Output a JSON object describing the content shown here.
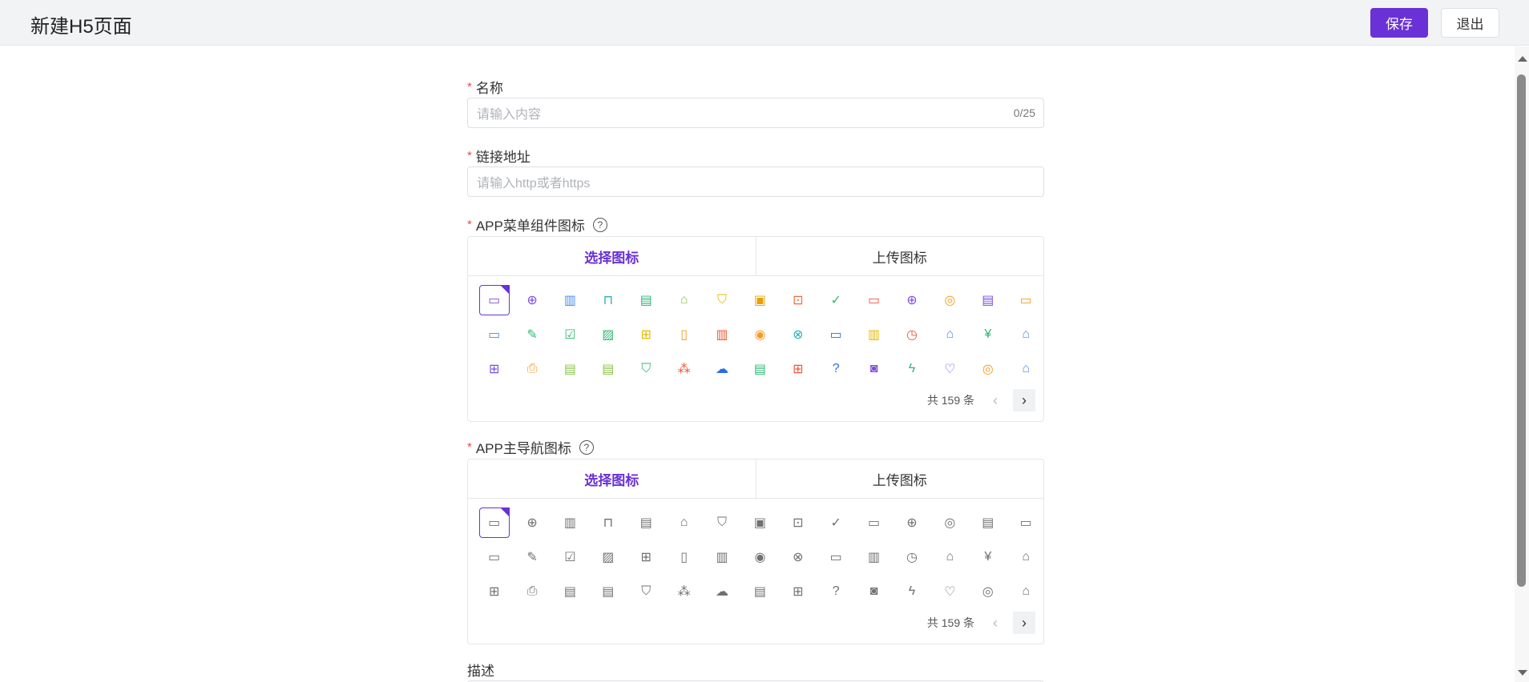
{
  "header": {
    "title": "新建H5页面",
    "save_label": "保存",
    "exit_label": "退出"
  },
  "form": {
    "name_label": "名称",
    "name_placeholder": "请输入内容",
    "name_count": "0/25",
    "url_label": "链接地址",
    "url_placeholder": "请输入http或者https",
    "menu_icon_label": "APP菜单组件图标",
    "nav_icon_label": "APP主导航图标",
    "desc_label": "描述"
  },
  "icon_picker": {
    "tab_select": "选择图标",
    "tab_upload": "上传图标",
    "total": "共 159 条",
    "icons": [
      {
        "name": "monitor-icon",
        "glyph": "▭",
        "color": "#7c4ddc"
      },
      {
        "name": "compass-icon",
        "glyph": "⊕",
        "color": "#7c4ddc"
      },
      {
        "name": "chart-icon",
        "glyph": "▥",
        "color": "#4a8de8"
      },
      {
        "name": "bag-icon",
        "glyph": "⊓",
        "color": "#2bb0b0"
      },
      {
        "name": "calendar-icon",
        "glyph": "▤",
        "color": "#2eb872"
      },
      {
        "name": "shopping-bag-icon",
        "glyph": "⌂",
        "color": "#8bc34a"
      },
      {
        "name": "shield-icon",
        "glyph": "⛉",
        "color": "#e6b800"
      },
      {
        "name": "screen-check-icon",
        "glyph": "▣",
        "color": "#e6a100"
      },
      {
        "name": "bookmark-icon",
        "glyph": "⊡",
        "color": "#f26b3a"
      },
      {
        "name": "check-circle-icon",
        "glyph": "✓",
        "color": "#2eb872"
      },
      {
        "name": "wallet-icon",
        "glyph": "▭",
        "color": "#f0563a"
      },
      {
        "name": "globe-icon",
        "glyph": "⊕",
        "color": "#7c4ddc"
      },
      {
        "name": "target-icon",
        "glyph": "◎",
        "color": "#f59b23"
      },
      {
        "name": "browser-icon",
        "glyph": "▤",
        "color": "#7c4ddc"
      },
      {
        "name": "inbox-icon",
        "glyph": "▭",
        "color": "#f59b23"
      },
      {
        "name": "archive-icon",
        "glyph": "▭",
        "color": "#4a8de8"
      },
      {
        "name": "pen-icon",
        "glyph": "✎",
        "color": "#2eb872"
      },
      {
        "name": "checkbox-icon",
        "glyph": "☑",
        "color": "#2eb872"
      },
      {
        "name": "image-icon",
        "glyph": "▨",
        "color": "#2eb872"
      },
      {
        "name": "signpost-icon",
        "glyph": "⊞",
        "color": "#e6b800"
      },
      {
        "name": "lock-icon",
        "glyph": "▯",
        "color": "#f59b23"
      },
      {
        "name": "building-icon",
        "glyph": "▥",
        "color": "#f0563a"
      },
      {
        "name": "audio-icon",
        "glyph": "◉",
        "color": "#f59b23"
      },
      {
        "name": "cross-circle-icon",
        "glyph": "⊗",
        "color": "#2bb0b0"
      },
      {
        "name": "window-icon",
        "glyph": "▭",
        "color": "#2b6de8"
      },
      {
        "name": "bar-icon",
        "glyph": "▥",
        "color": "#e6b800"
      },
      {
        "name": "clock-icon",
        "glyph": "◷",
        "color": "#f0563a"
      },
      {
        "name": "home-icon",
        "glyph": "⌂",
        "color": "#4a8de8"
      },
      {
        "name": "yen-icon",
        "glyph": "¥",
        "color": "#2eb872"
      },
      {
        "name": "store-icon",
        "glyph": "⌂",
        "color": "#4a8de8"
      },
      {
        "name": "apps-icon",
        "glyph": "⊞",
        "color": "#7c4ddc"
      },
      {
        "name": "printer-icon",
        "glyph": "⎙",
        "color": "#f59b23"
      },
      {
        "name": "clipboard-icon",
        "glyph": "▤",
        "color": "#8bc34a"
      },
      {
        "name": "save-icon",
        "glyph": "▤",
        "color": "#8bc34a"
      },
      {
        "name": "badge-icon",
        "glyph": "⛉",
        "color": "#2eb872"
      },
      {
        "name": "nodes-icon",
        "glyph": "⁂",
        "color": "#f0563a"
      },
      {
        "name": "cloud-upload-icon",
        "glyph": "☁",
        "color": "#2b6de8"
      },
      {
        "name": "document-icon",
        "glyph": "▤",
        "color": "#2eb872"
      },
      {
        "name": "grid-plus-icon",
        "glyph": "⊞",
        "color": "#f0563a"
      },
      {
        "name": "question-icon",
        "glyph": "?",
        "color": "#2b6de8"
      },
      {
        "name": "radio-icon",
        "glyph": "◙",
        "color": "#7c4ddc"
      },
      {
        "name": "bolt-icon",
        "glyph": "ϟ",
        "color": "#2eb872"
      },
      {
        "name": "bulb-icon",
        "glyph": "♡",
        "color": "#7c4ddc"
      },
      {
        "name": "medal-icon",
        "glyph": "◎",
        "color": "#f59b23"
      },
      {
        "name": "shop-icon",
        "glyph": "⌂",
        "color": "#4a8de8"
      }
    ]
  },
  "colors": {
    "primary": "#6a31d6",
    "required": "#e84b4b",
    "icon_gray": "#707070"
  }
}
